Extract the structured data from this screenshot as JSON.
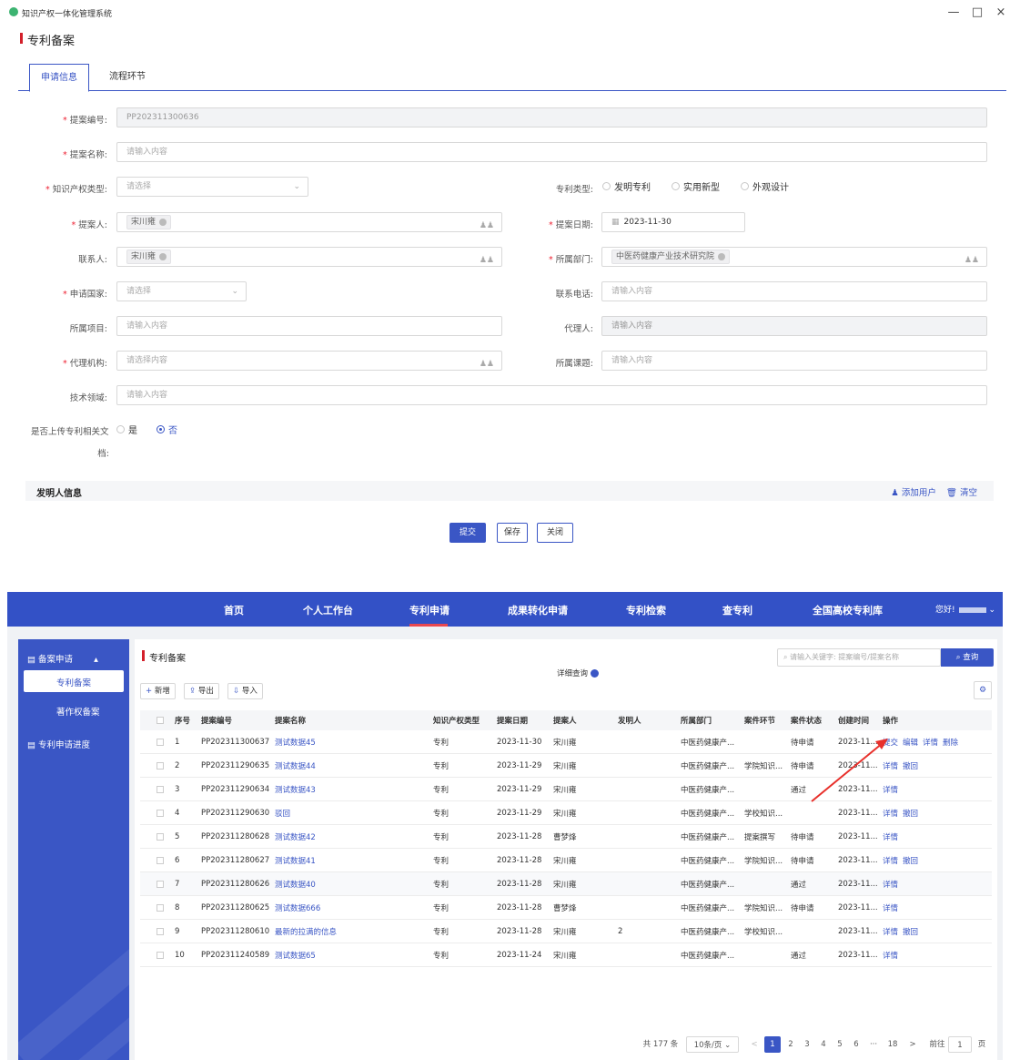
{
  "app": {
    "title": "知识产权一体化管理系统",
    "window_controls": [
      "—",
      "□",
      "×"
    ]
  },
  "form_page": {
    "title": "专利备案",
    "tabs": [
      "申请信息",
      "流程环节"
    ],
    "fields": {
      "proposal_no": {
        "label": "提案编号:",
        "value": "PP202311300636"
      },
      "proposal_name": {
        "label": "提案名称:",
        "placeholder": "请输入内容"
      },
      "ip_type": {
        "label": "知识产权类型:",
        "placeholder": "请选择"
      },
      "patent_type": {
        "label": "专利类型:",
        "options": [
          "发明专利",
          "实用新型",
          "外观设计"
        ]
      },
      "proposer": {
        "label": "提案人:",
        "tag": "宋川雍"
      },
      "proposal_date": {
        "label": "提案日期:",
        "value": "2023-11-30"
      },
      "contact": {
        "label": "联系人:",
        "tag": "宋川雍"
      },
      "department": {
        "label": "所属部门:",
        "tag": "中医药健康产业技术研究院"
      },
      "country": {
        "label": "申请国家:",
        "placeholder": "请选择"
      },
      "phone": {
        "label": "联系电话:",
        "placeholder": "请输入内容"
      },
      "project": {
        "label": "所属项目:",
        "placeholder": "请输入内容"
      },
      "agent": {
        "label": "代理人:",
        "placeholder": "请输入内容"
      },
      "agency": {
        "label": "代理机构:",
        "placeholder": "请选择内容"
      },
      "topic": {
        "label": "所属课题:",
        "placeholder": "请输入内容"
      },
      "tech_field": {
        "label": "技术领域:",
        "placeholder": "请输入内容"
      },
      "upload_docs": {
        "label_line1": "是否上传专利相关文",
        "label_line2": "档:",
        "yes": "是",
        "no": "否",
        "selected": "否"
      }
    },
    "inventor": {
      "title": "发明人信息",
      "add_user": "添加用户",
      "clear": "清空"
    },
    "buttons": {
      "submit": "提交",
      "save": "保存",
      "close": "关闭"
    }
  },
  "list_page": {
    "nav": [
      "首页",
      "个人工作台",
      "专利申请",
      "成果转化申请",
      "专利检索",
      "查专利",
      "全国高校专利库"
    ],
    "nav_active": "专利申请",
    "greeting": "您好!",
    "sidebar": {
      "group1": "备案申请",
      "items": [
        "专利备案",
        "著作权备案"
      ],
      "group2": "专利申请进度"
    },
    "title": "专利备案",
    "search_placeholder": "请输入关键字: 提案编号/提案名称",
    "search_button": "查询",
    "detail_query": "详细查询",
    "toolbar": {
      "add": "新增",
      "export": "导出",
      "import": "导入"
    },
    "columns": [
      "序号",
      "提案编号",
      "提案名称",
      "知识产权类型",
      "提案日期",
      "提案人",
      "发明人",
      "所属部门",
      "案件环节",
      "案件状态",
      "创建时间",
      "操作"
    ],
    "rows": [
      {
        "idx": "1",
        "no": "PP202311300637",
        "name": "测试数据45",
        "type": "专利",
        "date": "2023-11-30",
        "proposer": "宋川雍",
        "inventor": "",
        "dept": "中医药健康产...",
        "stage": "",
        "status": "待申请",
        "created": "2023-11...",
        "ops": [
          "提交",
          "编辑",
          "详情",
          "删除"
        ]
      },
      {
        "idx": "2",
        "no": "PP202311290635",
        "name": "测试数据44",
        "type": "专利",
        "date": "2023-11-29",
        "proposer": "宋川雍",
        "inventor": "",
        "dept": "中医药健康产...",
        "stage": "学院知识...",
        "status": "待申请",
        "created": "2023-11...",
        "ops": [
          "详情",
          "撤回"
        ]
      },
      {
        "idx": "3",
        "no": "PP202311290634",
        "name": "测试数据43",
        "type": "专利",
        "date": "2023-11-29",
        "proposer": "宋川雍",
        "inventor": "",
        "dept": "中医药健康产...",
        "stage": "",
        "status": "通过",
        "created": "2023-11...",
        "ops": [
          "详情"
        ]
      },
      {
        "idx": "4",
        "no": "PP202311290630",
        "name": "驳回",
        "type": "专利",
        "date": "2023-11-29",
        "proposer": "宋川雍",
        "inventor": "",
        "dept": "中医药健康产...",
        "stage": "学校知识...",
        "status": "",
        "created": "2023-11...",
        "ops": [
          "详情",
          "撤回"
        ]
      },
      {
        "idx": "5",
        "no": "PP202311280628",
        "name": "测试数据42",
        "type": "专利",
        "date": "2023-11-28",
        "proposer": "曹梦烽",
        "inventor": "",
        "dept": "中医药健康产...",
        "stage": "提案撰写",
        "status": "待申请",
        "created": "2023-11...",
        "ops": [
          "详情"
        ]
      },
      {
        "idx": "6",
        "no": "PP202311280627",
        "name": "测试数据41",
        "type": "专利",
        "date": "2023-11-28",
        "proposer": "宋川雍",
        "inventor": "",
        "dept": "中医药健康产...",
        "stage": "学院知识...",
        "status": "待申请",
        "created": "2023-11...",
        "ops": [
          "详情",
          "撤回"
        ]
      },
      {
        "idx": "7",
        "no": "PP202311280626",
        "name": "测试数据40",
        "type": "专利",
        "date": "2023-11-28",
        "proposer": "宋川雍",
        "inventor": "",
        "dept": "中医药健康产...",
        "stage": "",
        "status": "通过",
        "created": "2023-11...",
        "ops": [
          "详情"
        ]
      },
      {
        "idx": "8",
        "no": "PP202311280625",
        "name": "测试数据666",
        "type": "专利",
        "date": "2023-11-28",
        "proposer": "曹梦烽",
        "inventor": "",
        "dept": "中医药健康产...",
        "stage": "学院知识...",
        "status": "待申请",
        "created": "2023-11...",
        "ops": [
          "详情"
        ]
      },
      {
        "idx": "9",
        "no": "PP202311280610",
        "name": "最新的拉满的信息",
        "type": "专利",
        "date": "2023-11-28",
        "proposer": "宋川雍",
        "inventor": "2",
        "dept": "中医药健康产...",
        "stage": "学校知识...",
        "status": "",
        "created": "2023-11...",
        "ops": [
          "详情",
          "撤回"
        ]
      },
      {
        "idx": "10",
        "no": "PP202311240589",
        "name": "测试数据65",
        "type": "专利",
        "date": "2023-11-24",
        "proposer": "宋川雍",
        "inventor": "",
        "dept": "中医药健康产...",
        "stage": "",
        "status": "通过",
        "created": "2023-11...",
        "ops": [
          "详情"
        ]
      }
    ],
    "pagination": {
      "total": "共 177 条",
      "page_size": "10条/页",
      "pages": [
        "1",
        "2",
        "3",
        "4",
        "5",
        "6",
        "···",
        "18"
      ],
      "current": "1",
      "goto_prefix": "前往",
      "goto_value": "1",
      "goto_suffix": "页",
      "prev": "<",
      "next": ">"
    }
  },
  "colors": {
    "primary": "#3a56c5",
    "nav": "#3351c6",
    "accent_red": "#d3202b",
    "arrow": "#e8302b"
  }
}
